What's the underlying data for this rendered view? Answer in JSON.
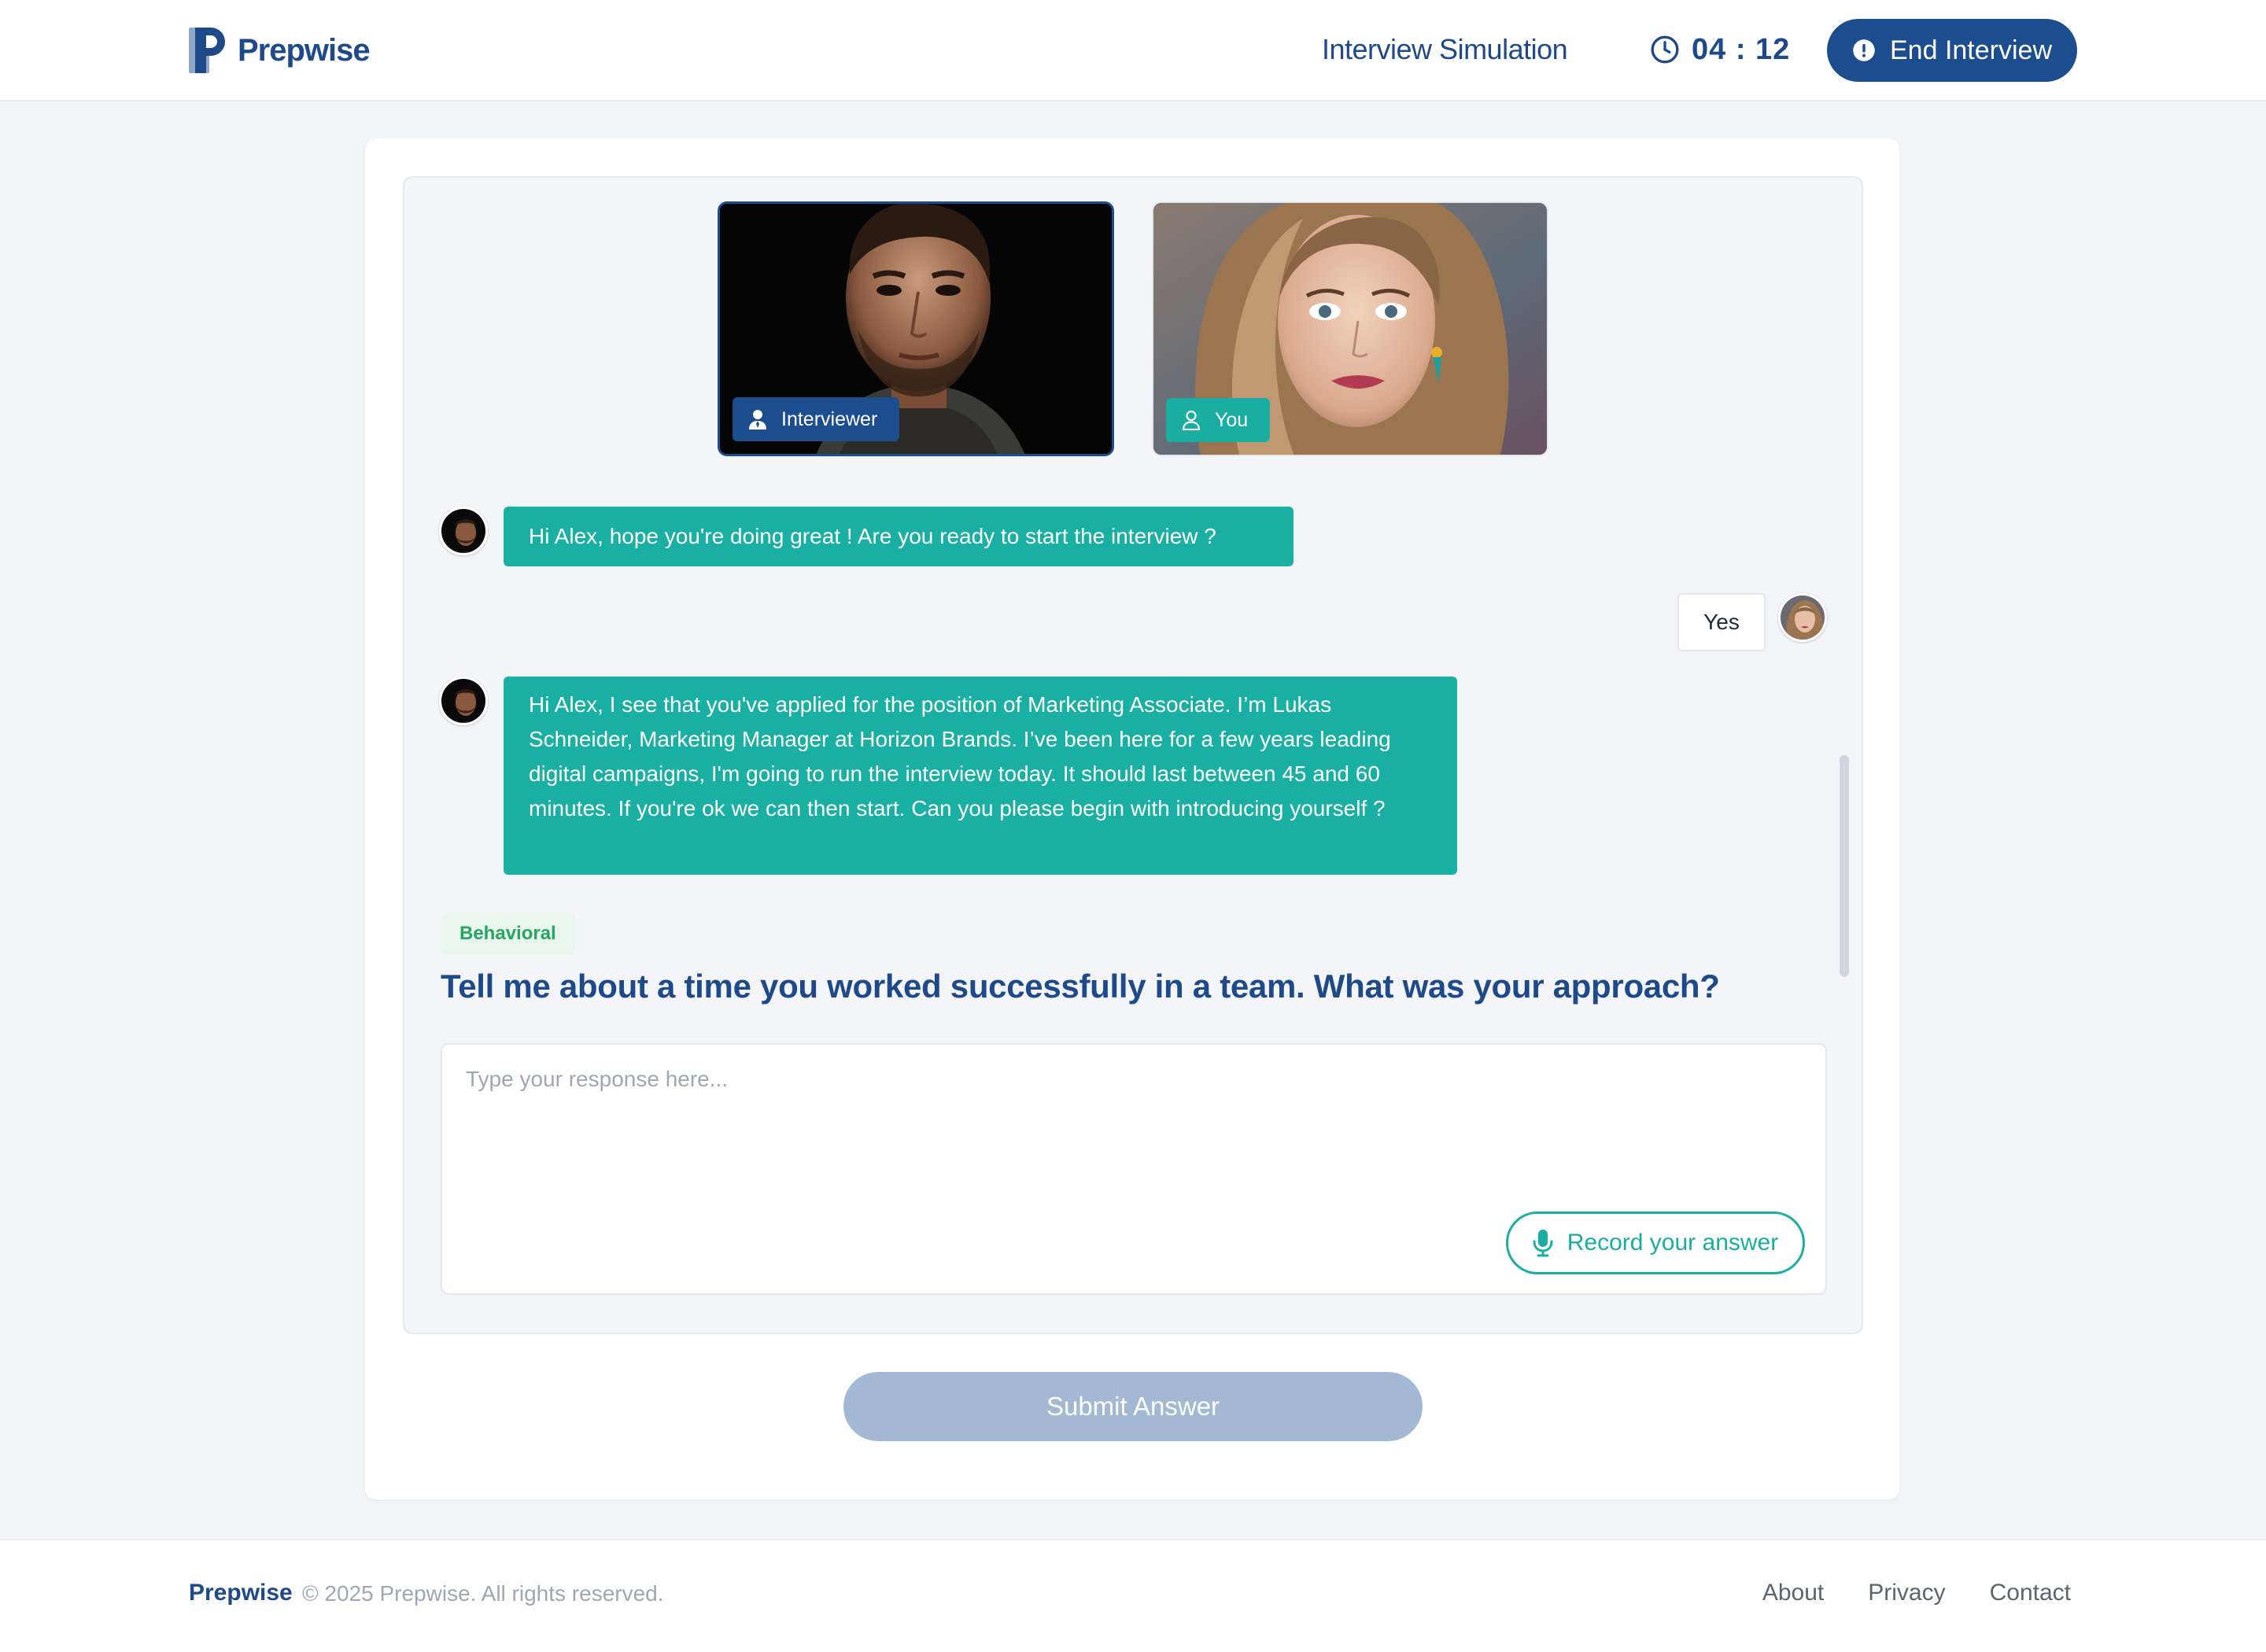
{
  "header": {
    "brand": "Prepwise",
    "nav_title": "Interview Simulation",
    "timer": "04 : 12",
    "end_button": "End Interview",
    "icons": {
      "logo": "prepwise-logo-icon",
      "timer": "clock-icon",
      "end": "alert-circle-icon"
    }
  },
  "videos": {
    "interviewer_label": "Interviewer",
    "you_label": "You"
  },
  "chat": {
    "messages": [
      {
        "from": "interviewer",
        "text": "Hi Alex, hope you're doing great ! Are you ready to start the interview ?"
      },
      {
        "from": "you",
        "text": "Yes"
      },
      {
        "from": "interviewer",
        "text": "Hi Alex,  I see that you've applied for the position of Marketing Associate. I’m Lukas Schneider, Marketing Manager at Horizon Brands. I’ve been here for a few years leading digital campaigns, I'm going to run the interview today. It should last between 45 and 60 minutes. If you're ok we can then start. Can you please begin with introducing yourself ?"
      }
    ]
  },
  "question": {
    "category": "Behavioral",
    "text": "Tell me about a time you worked successfully in a team. What was your approach?"
  },
  "answer": {
    "placeholder": "Type your response here...",
    "value": "",
    "record_button": "Record your answer"
  },
  "submit_button": "Submit Answer",
  "footer": {
    "brand": "Prepwise",
    "copyright": "© 2025 Prepwise. All rights reserved.",
    "links": [
      "About",
      "Privacy",
      "Contact"
    ]
  },
  "colors": {
    "primary": "#1c4d8e",
    "teal": "#1aaea2",
    "badge_green": "#27a561",
    "submit_disabled": "#a3b8d3"
  }
}
